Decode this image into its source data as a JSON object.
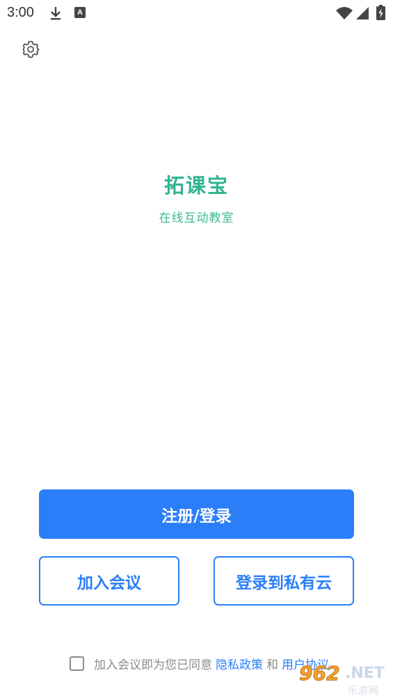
{
  "status_bar": {
    "time": "3:00",
    "icons": [
      "download-icon",
      "a-notification-icon",
      "wifi-icon",
      "signal-icon",
      "battery-charging-icon"
    ]
  },
  "toolbar": {
    "settings_icon": "gear-icon"
  },
  "app": {
    "title": "拓课宝",
    "subtitle": "在线互动教室"
  },
  "buttons": {
    "register_login": "注册/登录",
    "join_meeting": "加入会议",
    "login_private_cloud": "登录到私有云"
  },
  "agreement": {
    "checked": false,
    "prefix": "加入会议即为您已同意",
    "privacy_link": "隐私政策",
    "and": "和",
    "user_link": "用户协议"
  },
  "watermark": {
    "number": "962",
    "domain": ".NET",
    "site_name": "乐游网"
  },
  "colors": {
    "primary": "#2a7ef8",
    "brand_green": "#2fb58f"
  }
}
